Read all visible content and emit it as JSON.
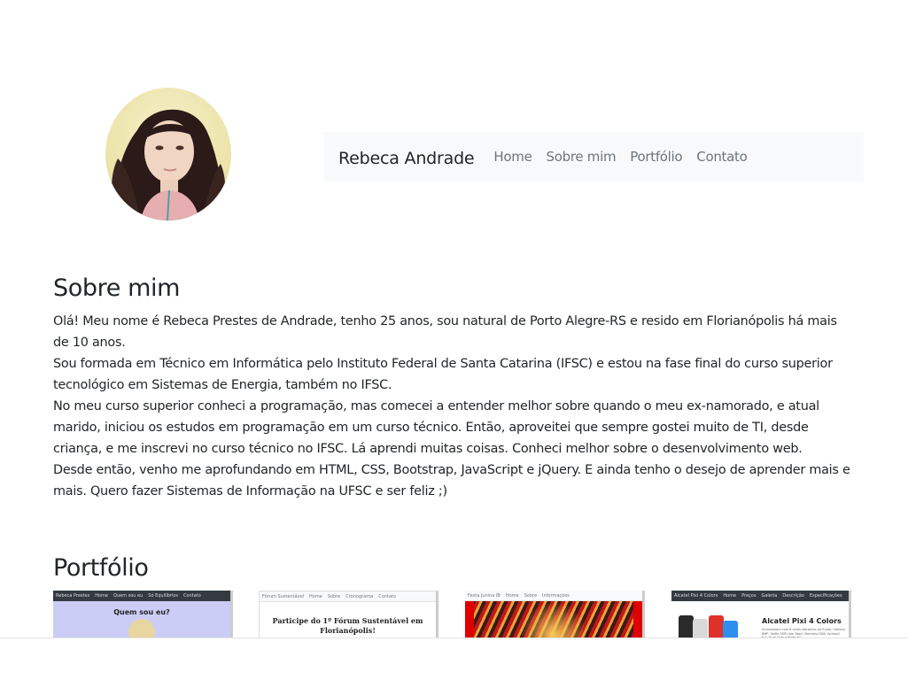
{
  "profile": {
    "avatar_icon": "profile-photo"
  },
  "navbar": {
    "brand": "Rebeca Andrade",
    "links": [
      "Home",
      "Sobre mim",
      "Portfólio",
      "Contato"
    ]
  },
  "about": {
    "title": "Sobre mim",
    "paragraphs": [
      "Olá! Meu nome é Rebeca Prestes de Andrade, tenho 25 anos, sou natural de Porto Alegre-RS e resido em Florianópolis há mais de 10 anos.",
      "Sou formada em Técnico em Informática pelo Instituto Federal de Santa Catarina (IFSC) e estou na fase final do curso superior tecnológico em Sistemas de Energia, também no IFSC.",
      "No meu curso superior conheci a programação, mas comecei a entender melhor sobre quando o meu ex-namorado, e atual marido, iniciou os estudos em programação em um curso técnico. Então, aproveitei que sempre gostei muito de TI, desde criança, e me inscrevi no curso técnico no IFSC. Lá aprendi muitas coisas. Conheci melhor sobre o desenvolvimento web.",
      "Desde então, venho me aprofundando em HTML, CSS, Bootstrap, JavaScript e jQuery. E ainda tenho o desejo de aprender mais e mais. Quero fazer Sistemas de Informação na UFSC e ser feliz ;)"
    ]
  },
  "portfolio": {
    "title": "Portfólio",
    "items": [
      {
        "nav": [
          "Rebeca Prestes",
          "Home",
          "Quem sou eu",
          "Só Equilíbrios",
          "Contato"
        ],
        "heading": "Quem sou eu?"
      },
      {
        "nav": [
          "Fórum Sustentável",
          "Home",
          "Sobre",
          "Cronograma",
          "Contato"
        ],
        "heading": "Participe do 1º Fórum Sustentável em Florianópolis!"
      },
      {
        "nav": [
          "Festa Junina IB",
          "Home",
          "Sobre",
          "Informações"
        ]
      },
      {
        "nav": [
          "Alcatel Pixi 4 Colors",
          "Home",
          "Preços",
          "Galeria",
          "Descrição",
          "Especificações"
        ],
        "heading": "Alcatel Pixi 4 Colors",
        "description": "Smartphone com 6 cores vibrantes de fundo, Câmera 8MP, Selfie 5MP com flash, Memória 8GB, Android 6.0, Dual Chip e Rede 3G."
      }
    ]
  },
  "colors": {
    "navbar_bg": "#f8f9fa",
    "nav_link": "#6c757d",
    "text": "#212529"
  }
}
